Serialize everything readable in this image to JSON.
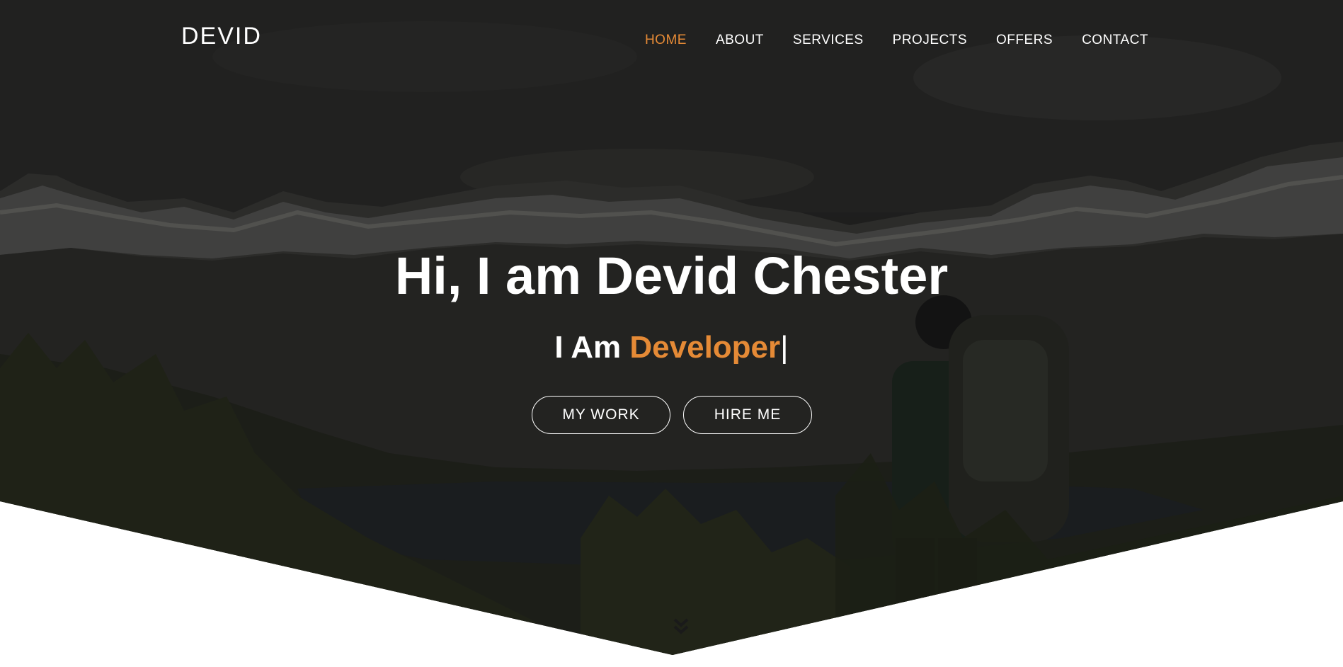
{
  "header": {
    "logo": "DEVID",
    "nav": [
      {
        "label": "HOME",
        "active": true
      },
      {
        "label": "ABOUT",
        "active": false
      },
      {
        "label": "SERVICES",
        "active": false
      },
      {
        "label": "PROJECTS",
        "active": false
      },
      {
        "label": "OFFERS",
        "active": false
      },
      {
        "label": "CONTACT",
        "active": false
      }
    ]
  },
  "hero": {
    "headline": "Hi, I am Devid Chester",
    "subline_prefix": "I Am ",
    "subline_accent": "Developer",
    "cursor": "|",
    "buttons": {
      "my_work": "MY WORK",
      "hire_me": "HIRE ME"
    },
    "scroll_icon": "double-chevron-down-icon"
  },
  "colors": {
    "accent": "#e58a36",
    "text": "#ffffff",
    "background": "#ffffff"
  }
}
